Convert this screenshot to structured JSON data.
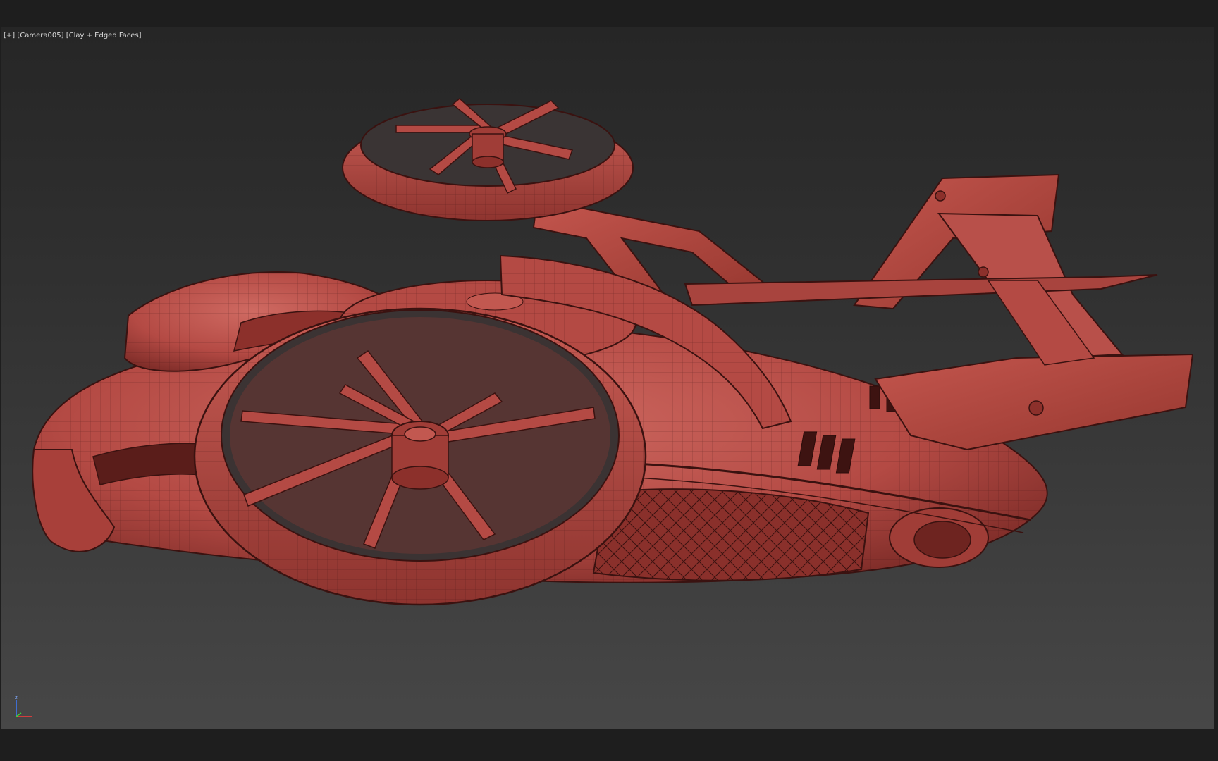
{
  "viewport": {
    "label_plus": "[+]",
    "label_camera": "[Camera005]",
    "label_shading": "[Clay + Edged Faces]"
  },
  "axis": {
    "z_label": "z",
    "icon": "xyz-axis-icon"
  },
  "colors": {
    "clay": "#b44a44",
    "clay_dark": "#7a2a26",
    "clay_light": "#cf6a62",
    "edge": "#3a1210",
    "bg_top": "#262626",
    "bg_bottom": "#474747",
    "chrome": "#1e1e1e"
  }
}
